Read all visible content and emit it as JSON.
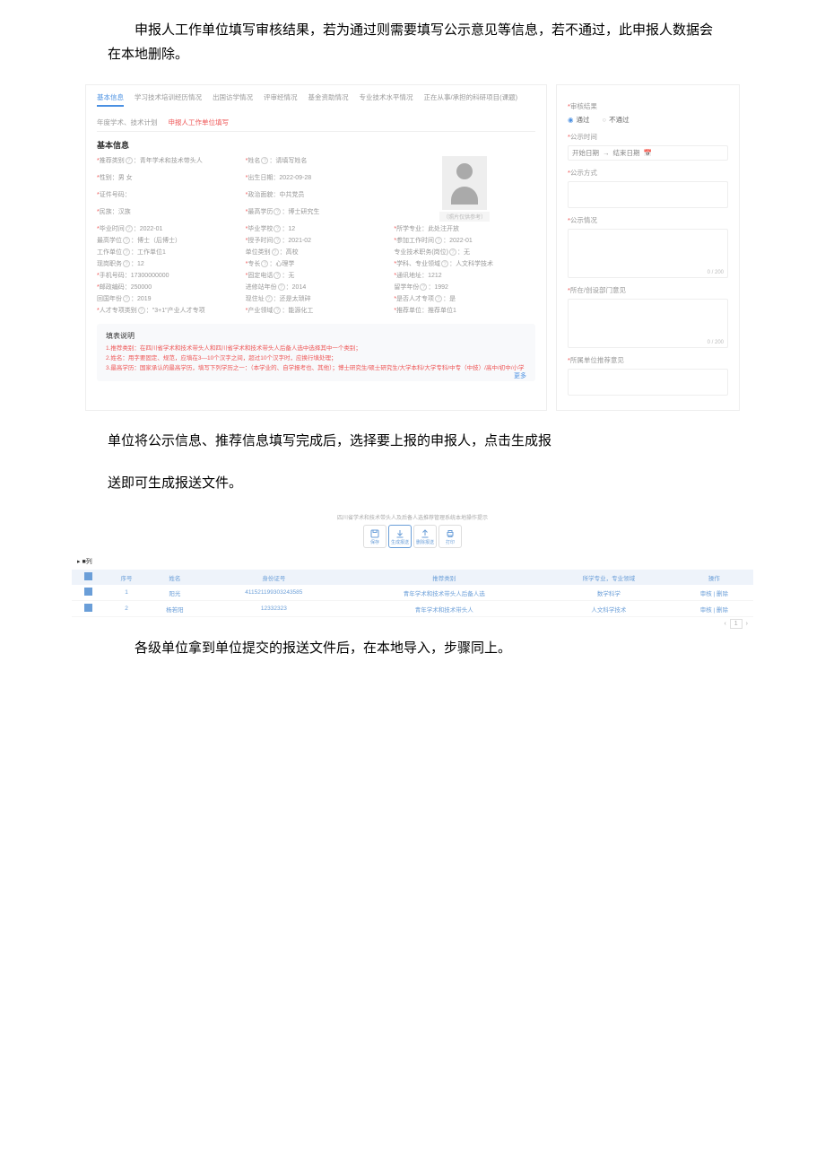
{
  "paragraphs": {
    "p1": "申报人工作单位填写审核结果，若为通过则需要填写公示意见等信息，若不通过，此申报人数据会在本地删除。",
    "p2a": "单位将公示信息、推荐信息填写完成后，选择要上报的申报人，点击生成报",
    "p2b": "送即可生成报送文件。",
    "p3": "各级单位拿到单位提交的报送文件后，在本地导入，步骤同上。"
  },
  "tabs": {
    "t1": "基本信息",
    "t2": "学习技术培训经历情况",
    "t3": "出国访学情况",
    "t4": "评审经情况",
    "t5": "基金资助情况",
    "t6": "专业技术水平情况",
    "t7": "正在从事/承担的科研项目(课题)",
    "t8": "年度学术、技术计划",
    "red": "申报人工作单位填写"
  },
  "section": "基本信息",
  "form": {
    "r1a": {
      "lab": "推荐类别",
      "val": "青年学术和技术带头人"
    },
    "r1b": {
      "lab": "姓名",
      "val": "请填写姓名"
    },
    "r2a": {
      "lab": "性别",
      "val": "男 女"
    },
    "r2b": {
      "lab": "出生日期",
      "val": "2022-09-28"
    },
    "r3a": {
      "lab": "证件号码",
      "val": ""
    },
    "r3b": {
      "lab": "政治面貌",
      "val": "中共党员"
    },
    "r4a": {
      "lab": "民族",
      "val": "汉族"
    },
    "r4b": {
      "lab": "最高学历",
      "val": "博士研究生"
    },
    "r5a": {
      "lab": "毕业时间",
      "val": "2022-01"
    },
    "r5b": {
      "lab": "毕业学校",
      "val": "12"
    },
    "r5c": {
      "lab": "所学专业",
      "val": "此处注开放"
    },
    "r6a": {
      "lab": "最高学位",
      "val": "博士（后博士）"
    },
    "r6b": {
      "lab": "授予时间",
      "val": "2021-02"
    },
    "r6c": {
      "lab": "参加工作时间",
      "val": "2022-01"
    },
    "r7a": {
      "lab": "工作单位",
      "val": "工作单位1"
    },
    "r7b": {
      "lab": "单位类别",
      "val": "高校"
    },
    "r7c": {
      "lab": "专业技术职务(岗位)",
      "val": "无"
    },
    "r8a": {
      "lab": "现岗职务",
      "val": "12"
    },
    "r8b": {
      "lab": "专长",
      "val": "心理学"
    },
    "r8c": {
      "lab": "学科、专业领域",
      "val": "人文科学技术"
    },
    "r9a": {
      "lab": "手机号码",
      "val": "17300000000"
    },
    "r9b": {
      "lab": "固定电话",
      "val": "无"
    },
    "r9c": {
      "lab": "通讯地址",
      "val": "1212"
    },
    "r10a": {
      "lab": "邮政编码",
      "val": "250000"
    },
    "r10b": {
      "lab": "进修站年份",
      "val": "2014"
    },
    "r10c": {
      "lab": "留学年份",
      "val": "1992"
    },
    "r11a": {
      "lab": "回国年份",
      "val": "2019"
    },
    "r11b": {
      "lab": "现住址",
      "val": "还是太琐碎"
    },
    "r11c": {
      "lab": "是否人才专项",
      "val": "是"
    },
    "r12a": {
      "lab": "人才专项类别",
      "val": "\"3+1\"产业人才专项"
    },
    "r12b": {
      "lab": "产业领域",
      "val": "能源化工"
    },
    "r12c": {
      "lab": "推荐单位",
      "val": "推荐单位1"
    }
  },
  "photo_label": "（照片仅供参考）",
  "notes": {
    "title": "填表说明",
    "n1": "1.推荐类别：在四川省学术和技术带头人和四川省学术和技术带头人后备人选中选择其中一个类别；",
    "n2": "2.姓名：用字要固定、规范，应填在3—10个汉字之间，超过10个汉字时，应换行填处理；",
    "n3": "3.最高学历：国家承认的最高学历，填写下列学历之一：（本学业的、自学报考也、其他）；博士研究生/硕士研究生/大学本科/大学专科/中专（中技）/高中/初中/小学",
    "more": "更多"
  },
  "right": {
    "h1": "审核结果",
    "r_pass": "通过",
    "r_fail": "不通过",
    "h2": "公示时间",
    "d1": "开始日期",
    "d2": "结束日期",
    "h3": "公示方式",
    "h4": "公示情况",
    "c1": "0 / 200",
    "h5": "所在/创设部门意见",
    "c2": "0 / 200",
    "h6": "所属单位推荐意见"
  },
  "toolbar": {
    "hint": "四川省学术和技术带头人及后备人选推荐管理系统本地操作提示",
    "i1": "保存",
    "i2": "生成报送",
    "i3": "删除报送",
    "i4": "打印"
  },
  "list_label": "■列",
  "table": {
    "h1": "序号",
    "h2": "姓名",
    "h3": "身份证号",
    "h4": "推荐类别",
    "h5": "所学专业，专业领域",
    "h6": "操作",
    "rows": [
      {
        "n": "1",
        "name": "阳光",
        "id": "411521199303243585",
        "cat": "青年学术和技术带头人后备人选",
        "field": "数学科学",
        "act": "审核 | 删除"
      },
      {
        "n": "2",
        "name": "杨若阳",
        "id": "12332323",
        "cat": "青年学术和技术带头人",
        "field": "人文科学技术",
        "act": "审核 | 删除"
      }
    ],
    "page": "1"
  }
}
